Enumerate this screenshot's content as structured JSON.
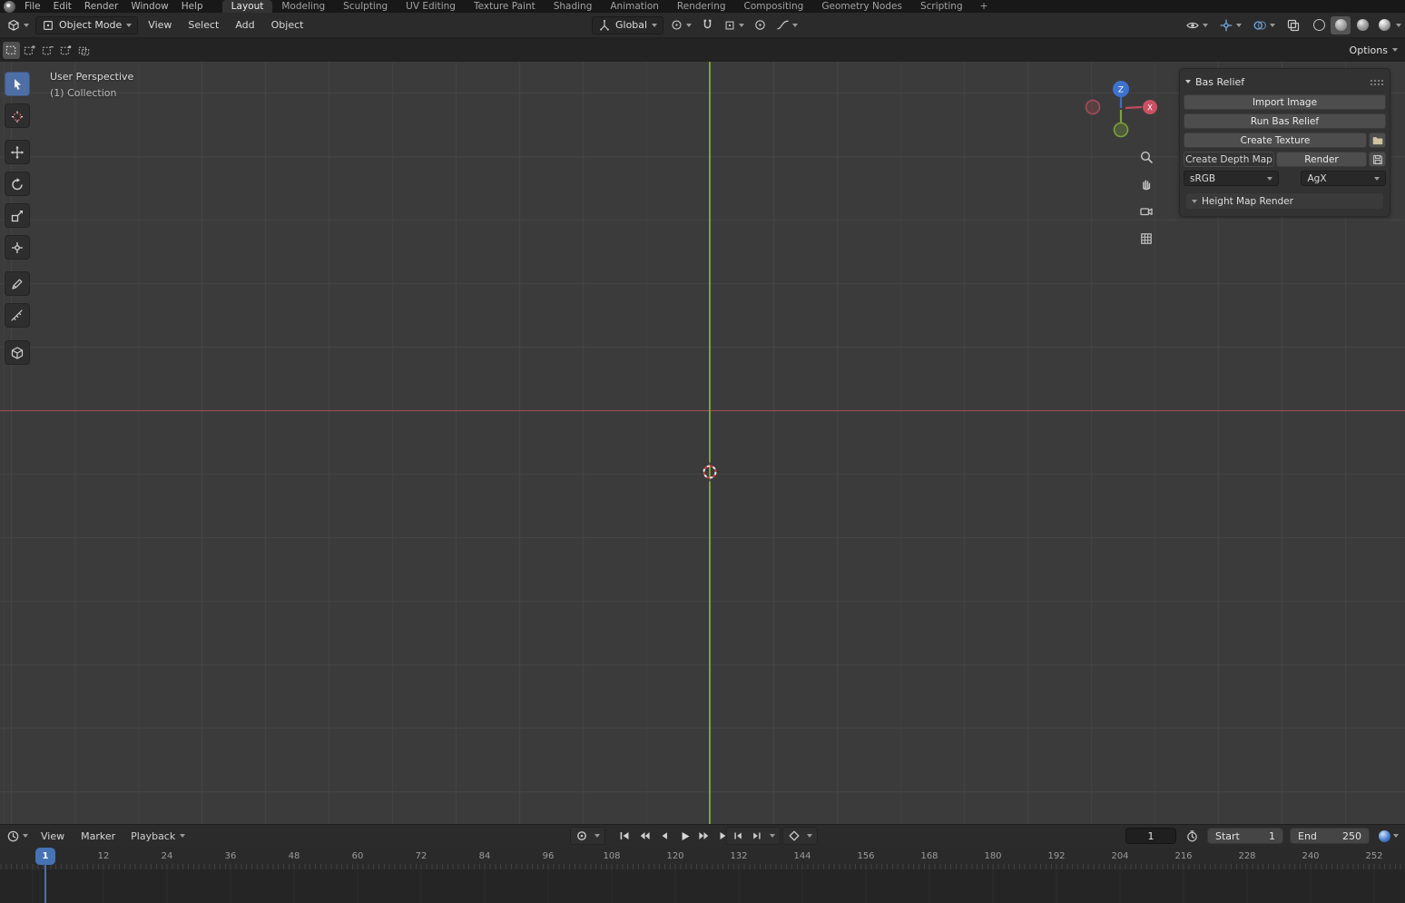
{
  "topbar": {
    "menus": [
      "File",
      "Edit",
      "Render",
      "Window",
      "Help"
    ],
    "workspaces": [
      "Layout",
      "Modeling",
      "Sculpting",
      "UV Editing",
      "Texture Paint",
      "Shading",
      "Animation",
      "Rendering",
      "Compositing",
      "Geometry Nodes",
      "Scripting"
    ],
    "add_tab": "+"
  },
  "header": {
    "mode": "Object Mode",
    "menus": [
      "View",
      "Select",
      "Add",
      "Object"
    ],
    "orientation": "Global",
    "options": "Options"
  },
  "viewport": {
    "view_label": "User Perspective",
    "collection_label": "(1) Collection",
    "gizmo": {
      "z": "Z",
      "x": "X"
    }
  },
  "panel": {
    "title": "Bas Relief",
    "import_image": "Import Image",
    "run_bas_relief": "Run Bas Relief",
    "create_texture": "Create Texture",
    "create_depth_map": "Create Depth Map",
    "render": "Render",
    "color_space": "sRGB",
    "view_transform": "AgX",
    "height_map_render": "Height Map Render"
  },
  "timeline": {
    "menus": [
      "View",
      "Marker",
      "Playback"
    ],
    "current_frame": "1",
    "start_label": "Start",
    "start_value": "1",
    "end_label": "End",
    "end_value": "250",
    "playhead_frame": "1",
    "ticks": [
      "12",
      "24",
      "36",
      "48",
      "60",
      "72",
      "84",
      "96",
      "108",
      "120",
      "132",
      "144",
      "156",
      "168",
      "180",
      "192",
      "204",
      "216",
      "228",
      "240",
      "252"
    ]
  },
  "colors": {
    "accent_blue": "#4772b3",
    "axis_x_red": "#a14b58",
    "axis_y_green": "#7aa33a",
    "viewport_bg": "#3b3b3b"
  }
}
